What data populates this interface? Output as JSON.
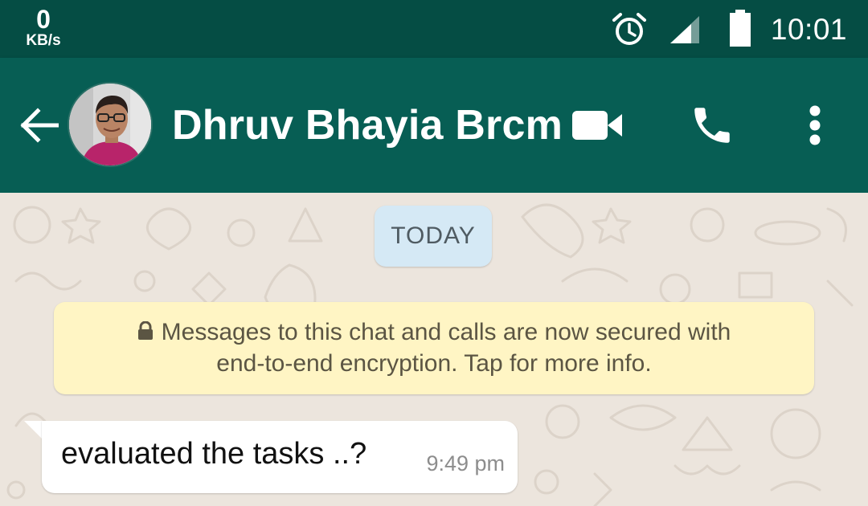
{
  "status_bar": {
    "net_speed_value": "0",
    "net_speed_unit": "KB/s",
    "time": "10:01",
    "icons": [
      "alarm-icon",
      "signal-icon",
      "battery-icon"
    ]
  },
  "header": {
    "contact_name": "Dhruv Bhayia Brcm",
    "icons": [
      "back-arrow-icon",
      "avatar",
      "video-call-icon",
      "phone-call-icon",
      "more-options-icon"
    ]
  },
  "chat": {
    "date_label": "TODAY",
    "encryption_notice": {
      "line1": "Messages to this chat and calls are now secured with",
      "line2": "end-to-end encryption. Tap for more info.",
      "icon": "lock-icon"
    },
    "messages": [
      {
        "text": "evaluated the tasks ..?",
        "time": "9:49 pm",
        "direction": "incoming"
      }
    ]
  },
  "colors": {
    "status_bar": "#054D44",
    "app_bar": "#075E54",
    "chat_background": "#ECE5DD",
    "date_chip": "#D5E9F5",
    "notice_background": "#FFF5C4",
    "incoming_bubble": "#FFFFFF"
  }
}
